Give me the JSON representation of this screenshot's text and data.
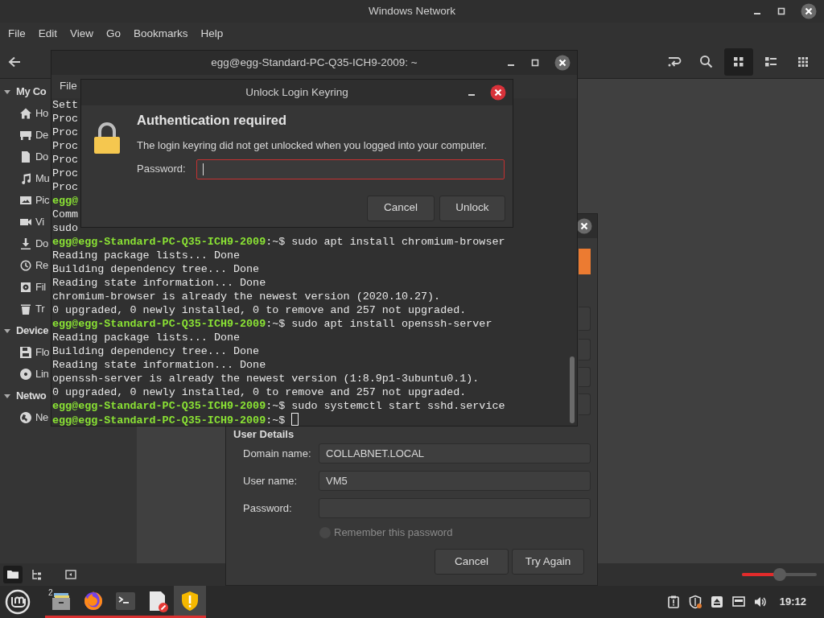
{
  "file_manager": {
    "title": "Windows Network",
    "menu": [
      "File",
      "Edit",
      "View",
      "Go",
      "Bookmarks",
      "Help"
    ],
    "toolbar": [
      {
        "kind": "toggle",
        "selected": false
      },
      {
        "kind": "search",
        "selected": false
      },
      {
        "kind": "icons",
        "selected": true
      },
      {
        "kind": "list",
        "selected": false
      },
      {
        "kind": "compact",
        "selected": false
      }
    ],
    "sidebar": [
      {
        "heading": "My Co",
        "expanded": true,
        "children": [
          {
            "kind": "home",
            "label": "Ho"
          },
          {
            "kind": "desktop",
            "label": "De"
          },
          {
            "kind": "document",
            "label": "Do"
          },
          {
            "kind": "music",
            "label": "Mu"
          },
          {
            "kind": "pictures",
            "label": "Pic"
          },
          {
            "kind": "videos",
            "label": "Vi"
          },
          {
            "kind": "downloads",
            "label": "Do"
          },
          {
            "kind": "recent",
            "label": "Re"
          },
          {
            "kind": "filesystem",
            "label": "Fil"
          },
          {
            "kind": "trash",
            "label": "Tr"
          }
        ]
      },
      {
        "heading": "Device",
        "expanded": true,
        "children": [
          {
            "kind": "floppy",
            "label": "Flo"
          },
          {
            "kind": "disc",
            "label": "Lin"
          }
        ]
      },
      {
        "heading": "Netwo",
        "expanded": true,
        "children": [
          {
            "kind": "network",
            "label": "Ne"
          }
        ]
      }
    ],
    "status_buttons": [
      {
        "kind": "places",
        "selected": true
      },
      {
        "kind": "tree",
        "selected": false
      },
      {
        "kind": "sidebar",
        "selected": false
      }
    ],
    "zoom": {
      "level": 0.5
    }
  },
  "network_dialog": {
    "section_title": "User Details",
    "fields": [
      {
        "label": "Domain name:",
        "value": "COLLABNET.LOCAL"
      },
      {
        "label": "User name:",
        "value": "VM5"
      },
      {
        "label": "Password:"
      }
    ],
    "remember": {
      "label": "Remember this password",
      "checked": false,
      "disabled": true
    },
    "buttons": [
      "Cancel",
      "Try Again"
    ]
  },
  "terminal": {
    "title": "egg@egg-Standard-PC-Q35-ICH9-2009: ~",
    "menu": [
      "File"
    ],
    "lines": [
      {
        "kind": "output",
        "text": "Sett"
      },
      {
        "kind": "output",
        "text": "Proc"
      },
      {
        "kind": "output",
        "text": "Proc"
      },
      {
        "kind": "output",
        "text": "Proc"
      },
      {
        "kind": "output",
        "text": "Proc"
      },
      {
        "kind": "output",
        "text": "Proc"
      },
      {
        "kind": "output",
        "text": "Proc"
      },
      {
        "kind": "prompt",
        "prompt": "egg@"
      },
      {
        "kind": "output",
        "text": "Comm"
      },
      {
        "kind": "output",
        "text": "sudo"
      },
      {
        "kind": "prompt",
        "prompt": "egg@egg-Standard-PC-Q35-ICH9-2009",
        "path": ":~$",
        "command": "sudo apt install chromium-browser"
      },
      {
        "kind": "output",
        "text": "Reading package lists... Done"
      },
      {
        "kind": "output",
        "text": "Building dependency tree... Done"
      },
      {
        "kind": "output",
        "text": "Reading state information... Done"
      },
      {
        "kind": "output",
        "text": "chromium-browser is already the newest version (2020.10.27)."
      },
      {
        "kind": "output",
        "text": "0 upgraded, 0 newly installed, 0 to remove and 257 not upgraded."
      },
      {
        "kind": "prompt",
        "prompt": "egg@egg-Standard-PC-Q35-ICH9-2009",
        "path": ":~$",
        "command": "sudo apt install openssh-server"
      },
      {
        "kind": "output",
        "text": "Reading package lists... Done"
      },
      {
        "kind": "output",
        "text": "Building dependency tree... Done"
      },
      {
        "kind": "output",
        "text": "Reading state information... Done"
      },
      {
        "kind": "output",
        "text": "openssh-server is already the newest version (1:8.9p1-3ubuntu0.1)."
      },
      {
        "kind": "output",
        "text": "0 upgraded, 0 newly installed, 0 to remove and 257 not upgraded."
      },
      {
        "kind": "prompt",
        "prompt": "egg@egg-Standard-PC-Q35-ICH9-2009",
        "path": ":~$",
        "command": "sudo systemctl start sshd.service"
      },
      {
        "kind": "prompt",
        "prompt": "egg@egg-Standard-PC-Q35-ICH9-2009",
        "path": ":~$",
        "cursor": true
      }
    ]
  },
  "keyring_dialog": {
    "title": "Unlock Login Keyring",
    "heading": "Authentication required",
    "message": "The login keyring did not get unlocked when you logged into your computer.",
    "password_label": "Password:",
    "password_focused": true,
    "buttons": [
      "Cancel",
      "Unlock"
    ]
  },
  "taskbar": {
    "apps": [
      {
        "kind": "files",
        "badge": "2",
        "running": true,
        "selected": false
      },
      {
        "kind": "browser",
        "running": true,
        "selected": false
      },
      {
        "kind": "terminal",
        "running": true,
        "selected": false
      },
      {
        "kind": "editor",
        "running": true,
        "selected": false
      },
      {
        "kind": "shield",
        "running": true,
        "selected": true
      }
    ],
    "tray": [
      {
        "kind": "clipboard"
      },
      {
        "kind": "security"
      },
      {
        "kind": "eject"
      },
      {
        "kind": "network"
      },
      {
        "kind": "volume"
      }
    ],
    "clock": "19:12"
  }
}
